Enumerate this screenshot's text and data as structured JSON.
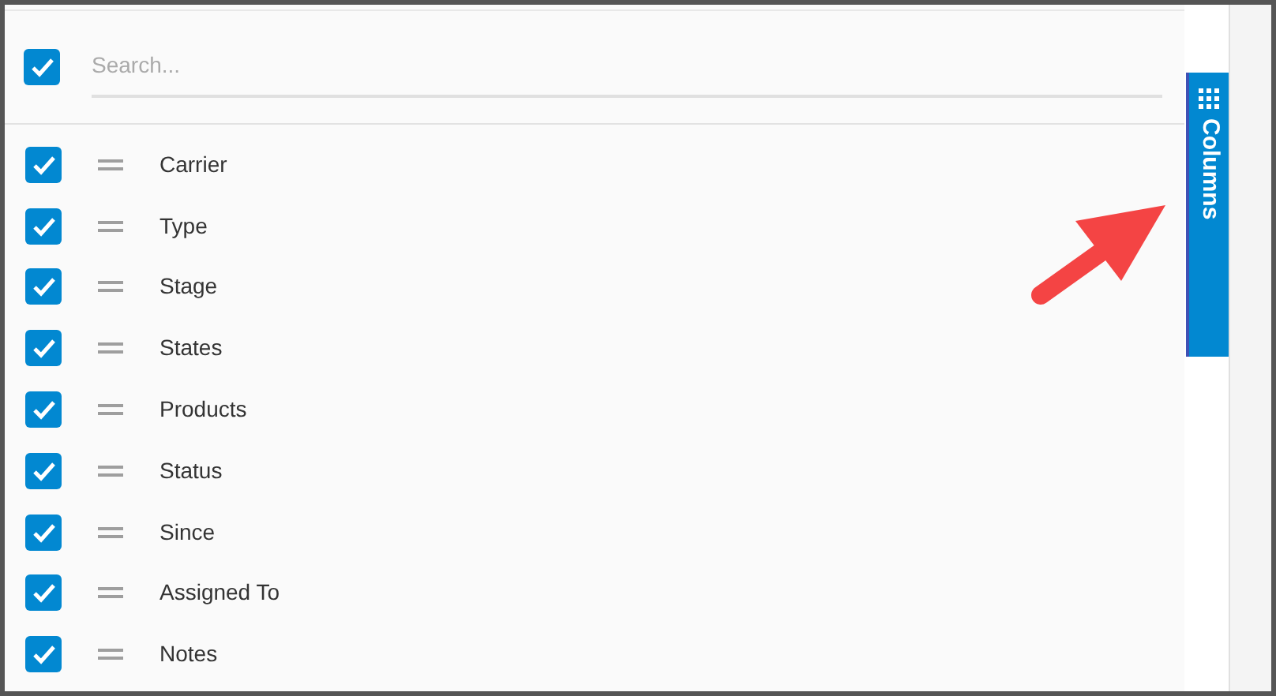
{
  "header": {
    "select_all_checked": true,
    "search": {
      "placeholder": "Search..."
    }
  },
  "columns": [
    {
      "label": "Carrier",
      "checked": true
    },
    {
      "label": "Type",
      "checked": true
    },
    {
      "label": "Stage",
      "checked": true
    },
    {
      "label": "States",
      "checked": true
    },
    {
      "label": "Products",
      "checked": true
    },
    {
      "label": "Status",
      "checked": true
    },
    {
      "label": "Since",
      "checked": true
    },
    {
      "label": "Assigned To",
      "checked": true
    },
    {
      "label": "Notes",
      "checked": true
    }
  ],
  "side_tab": {
    "label": "Columns"
  }
}
